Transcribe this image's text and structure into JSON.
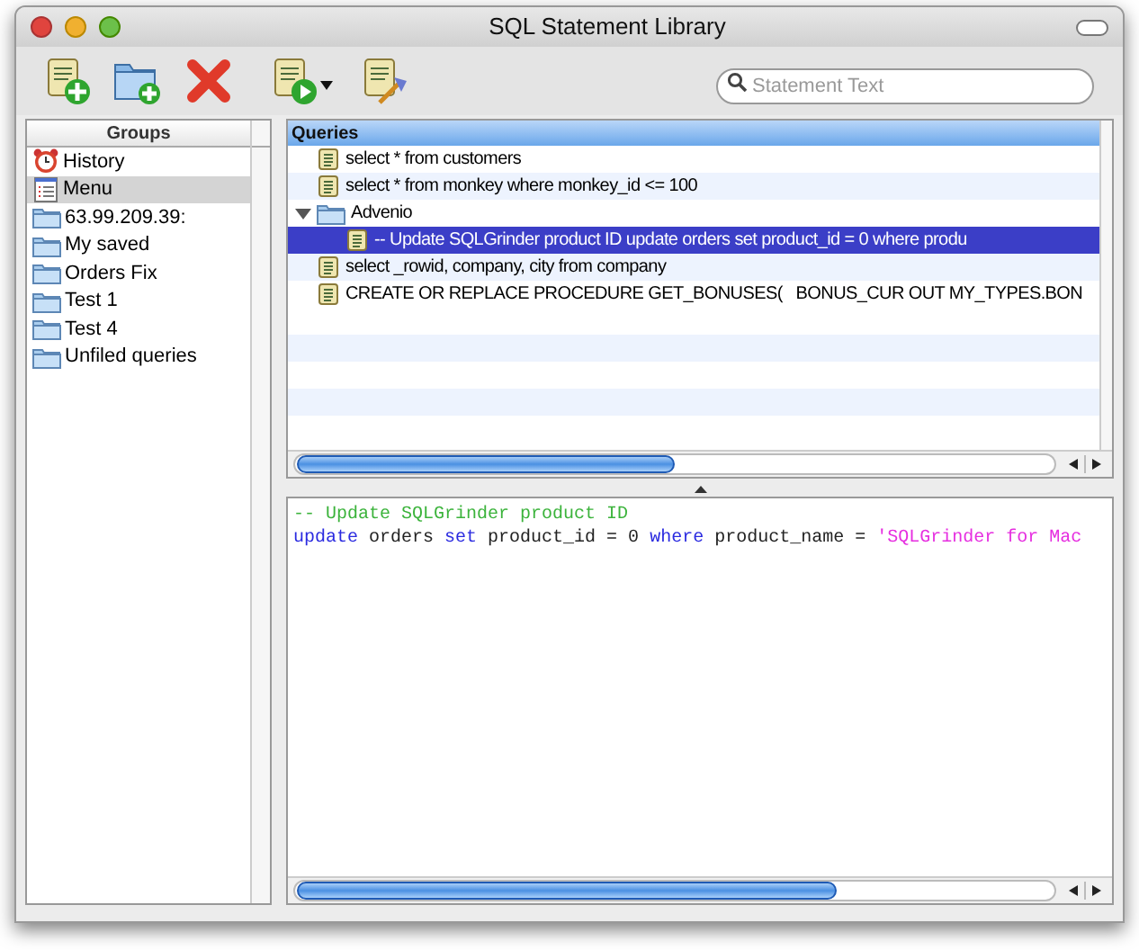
{
  "window": {
    "title": "SQL Statement Library"
  },
  "search": {
    "placeholder": "Statement Text"
  },
  "groups": {
    "header": "Groups",
    "items": [
      {
        "kind": "history",
        "label": "History",
        "selected": false
      },
      {
        "kind": "menu",
        "label": "Menu",
        "selected": true
      },
      {
        "kind": "folder",
        "label": "63.99.209.39:",
        "selected": false
      },
      {
        "kind": "folder",
        "label": "My saved",
        "selected": false
      },
      {
        "kind": "folder",
        "label": "Orders Fix",
        "selected": false
      },
      {
        "kind": "folder",
        "label": "Test 1",
        "selected": false
      },
      {
        "kind": "folder",
        "label": "Test 4",
        "selected": false
      },
      {
        "kind": "folder",
        "label": "Unfiled queries",
        "selected": false
      }
    ]
  },
  "queries": {
    "header": "Queries",
    "rows": [
      {
        "kind": "statement",
        "label": "select * from customers",
        "selected": false
      },
      {
        "kind": "statement",
        "label": "select * from monkey where monkey_id <= 100",
        "selected": false
      },
      {
        "kind": "folder",
        "label": "Advenio",
        "expanded": true,
        "selected": false,
        "children": [
          {
            "kind": "statement",
            "label": "-- Update SQLGrinder product ID update orders set product_id = 0 where produ",
            "selected": true
          }
        ]
      },
      {
        "kind": "statement",
        "label": "select _rowid, company, city from company",
        "selected": false
      },
      {
        "kind": "statement",
        "label": "CREATE OR REPLACE PROCEDURE GET_BONUSES(   BONUS_CUR OUT MY_TYPES.BON",
        "selected": false
      }
    ]
  },
  "editor": {
    "lines": [
      [
        {
          "kind": "comment",
          "text": "-- Update SQLGrinder product ID"
        }
      ],
      [
        {
          "kind": "keyword",
          "text": "update"
        },
        {
          "kind": "plain",
          "text": " orders "
        },
        {
          "kind": "keyword",
          "text": "set"
        },
        {
          "kind": "plain",
          "text": " product_id = 0 "
        },
        {
          "kind": "keyword",
          "text": "where"
        },
        {
          "kind": "plain",
          "text": " product_name = "
        },
        {
          "kind": "string",
          "text": "'SQLGrinder for Mac"
        }
      ]
    ]
  }
}
